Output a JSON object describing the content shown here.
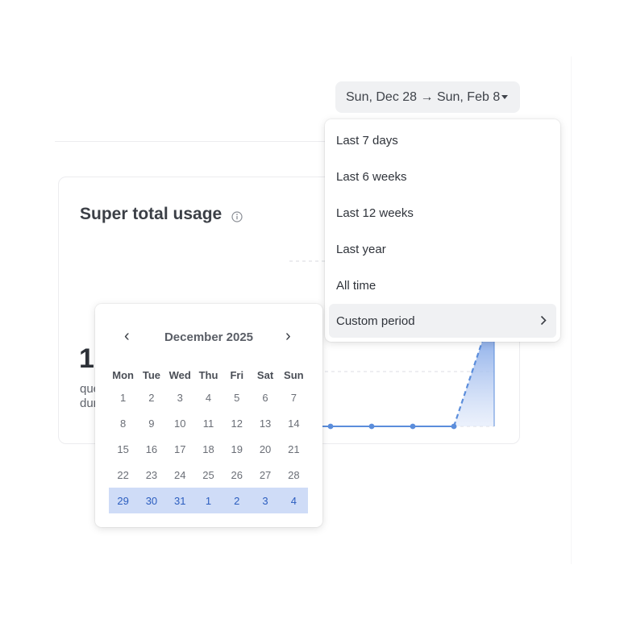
{
  "date_range": {
    "label": "Sun, Dec 28 → Sun, Feb 8"
  },
  "card": {
    "title": "Super total usage",
    "big_number": "1",
    "line1": "que",
    "line2": "dur"
  },
  "menu": {
    "items": [
      {
        "label": "Last 7 days"
      },
      {
        "label": "Last 6 weeks"
      },
      {
        "label": "Last 12 weeks"
      },
      {
        "label": "Last year"
      },
      {
        "label": "All time"
      },
      {
        "label": "Custom period"
      }
    ]
  },
  "calendar": {
    "month": "December 2025",
    "prev": "‹",
    "next": "›",
    "weekdays": [
      "Mon",
      "Tue",
      "Wed",
      "Thu",
      "Fri",
      "Sat",
      "Sun"
    ],
    "weeks": [
      [
        "1",
        "2",
        "3",
        "4",
        "5",
        "6",
        "7"
      ],
      [
        "8",
        "9",
        "10",
        "11",
        "12",
        "13",
        "14"
      ],
      [
        "15",
        "16",
        "17",
        "18",
        "19",
        "20",
        "21"
      ],
      [
        "22",
        "23",
        "24",
        "25",
        "26",
        "27",
        "28"
      ],
      [
        "29",
        "30",
        "31",
        "1",
        "2",
        "3",
        "4"
      ]
    ]
  },
  "colors": {
    "accent": "#5b8ddb",
    "selection": "#cfdcf7",
    "selection_text": "#2b5dbf"
  }
}
